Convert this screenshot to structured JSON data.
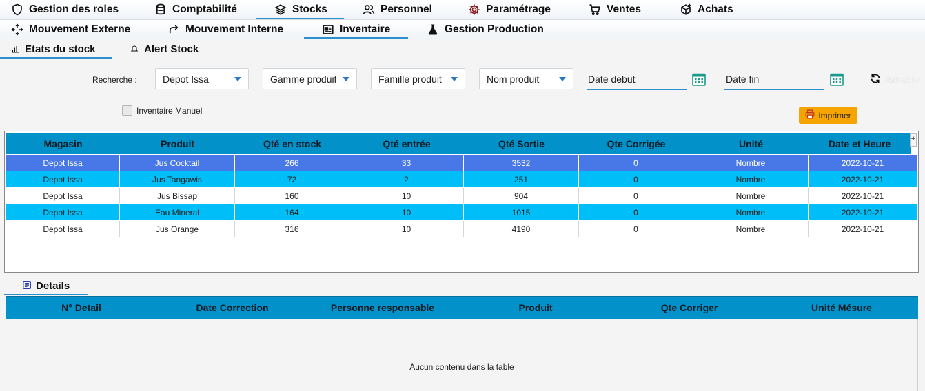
{
  "main_nav": [
    {
      "label": "Gestion des roles",
      "icon": "shield-icon"
    },
    {
      "label": "Comptabilité",
      "icon": "database-icon"
    },
    {
      "label": "Stocks",
      "icon": "layers-icon",
      "active": true
    },
    {
      "label": "Personnel",
      "icon": "users-icon"
    },
    {
      "label": "Paramétrage",
      "icon": "gear-icon"
    },
    {
      "label": "Ventes",
      "icon": "cart-icon"
    },
    {
      "label": "Achats",
      "icon": "box-add-icon"
    }
  ],
  "sub_nav": [
    {
      "label": "Mouvement Externe",
      "icon": "move-arrows-icon"
    },
    {
      "label": "Mouvement Interne",
      "icon": "redo-arrow-icon"
    },
    {
      "label": "Inventaire",
      "icon": "inventory-card-icon",
      "active": true
    },
    {
      "label": "Gestion Production",
      "icon": "flask-icon"
    }
  ],
  "sub_sub_nav": [
    {
      "label": "Etats du stock",
      "icon": "bar-chart-icon",
      "active": true
    },
    {
      "label": "Alert Stock",
      "icon": "bell-icon"
    }
  ],
  "filters": {
    "search_label": "Recherche :",
    "depot": "Depot Issa",
    "gamme": "Gamme produit",
    "famille": "Famille produit",
    "nom": "Nom produit",
    "date_debut": "Date debut",
    "date_fin": "Date fin",
    "refresh_label": "Rafraîchir"
  },
  "manual_inventory_label": "Inventaire Manuel",
  "print_label": "Imprimer",
  "stock_table": {
    "columns": [
      "Magasin",
      "Produit",
      "Qté en stock",
      "Qté entrée",
      "Qté Sortie",
      "Qte Corrigée",
      "Unité",
      "Date et Heure"
    ],
    "rows": [
      [
        "Depot Issa",
        "Jus Cocktail",
        "266",
        "33",
        "3532",
        "0",
        "Nombre",
        "2022-10-21"
      ],
      [
        "Depot Issa",
        "Jus Tangawis",
        "72",
        "2",
        "251",
        "0",
        "Nombre",
        "2022-10-21"
      ],
      [
        "Depot Issa",
        "Jus Bissap",
        "160",
        "10",
        "904",
        "0",
        "Nombre",
        "2022-10-21"
      ],
      [
        "Depot Issa",
        "Eau Mineral",
        "164",
        "10",
        "1015",
        "0",
        "Nombre",
        "2022-10-21"
      ],
      [
        "Depot Issa",
        "Jus Orange",
        "316",
        "10",
        "4190",
        "0",
        "Nombre",
        "2022-10-21"
      ]
    ],
    "expand_label": "+"
  },
  "details": {
    "tab_label": "Details",
    "columns": [
      "N° Detail",
      "Date Correction",
      "Personne responsable",
      "Produit",
      "Qte Corriger",
      "Unité Mésure"
    ],
    "empty_message": "Aucun contenu dans la table"
  },
  "colors": {
    "header_blue": "#0291c9",
    "selected_row": "#4878e8",
    "cyan_row": "#00bef8",
    "accent": "#2b8fd0",
    "print_button": "#f5a400"
  }
}
